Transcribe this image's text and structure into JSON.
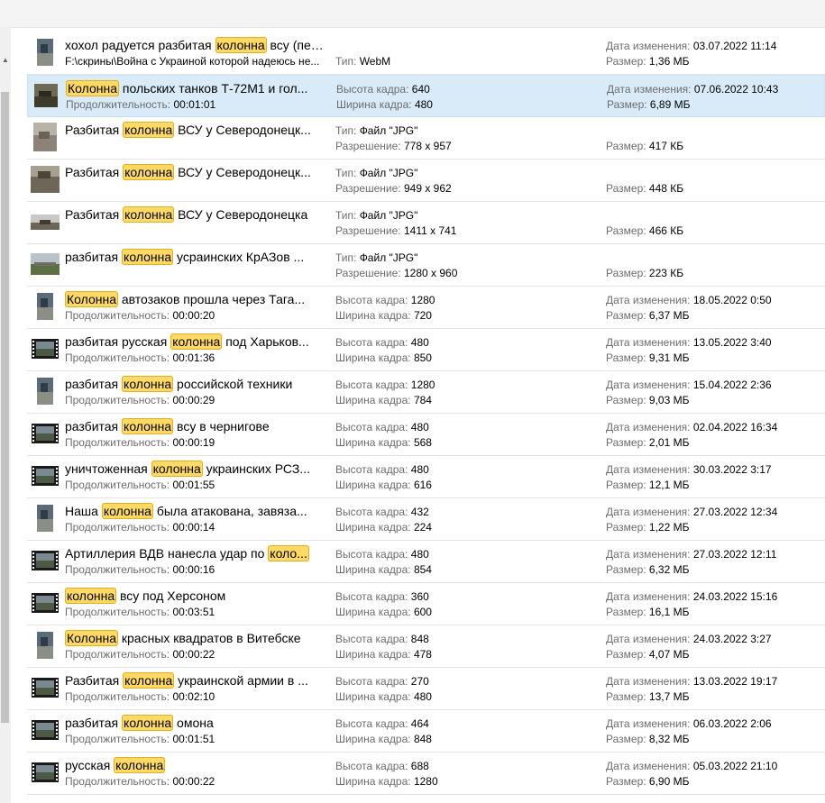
{
  "labels": {
    "date": "Дата изменения:",
    "size": "Размер:",
    "type": "Тип:",
    "resolution": "Разрешение:",
    "height": "Высота кадра:",
    "width": "Ширина кадра:",
    "duration": "Продолжительность:"
  },
  "rows": [
    {
      "kind": "path",
      "pre": "хохол радуется разбитая ",
      "hl": "колонна",
      "post": " всу (первый день войны)",
      "sub": "F:\\скрины\\Война с Украиной которой надеюсь не...",
      "c2a_label": "",
      "c2a": "",
      "c2b_label": "Тип:",
      "c2b": "WebM",
      "c3a_label": "Дата изменения:",
      "c3a": "03.07.2022 11:14",
      "c3b_label": "Размер:",
      "c3b": "1,36 МБ",
      "thumb": "portrait-video"
    },
    {
      "kind": "video",
      "pre": "",
      "hl": "Колонна",
      "post": " польских танков Т-72М1 и гол...",
      "sub": "00:01:01",
      "c2a_label": "Высота кадра:",
      "c2a": "640",
      "c2b_label": "Ширина кадра:",
      "c2b": "480",
      "c3a_label": "Дата изменения:",
      "c3a": "07.06.2022 10:43",
      "c3b_label": "Размер:",
      "c3b": "6,89 МБ",
      "thumb": "landscape-video",
      "selected": true
    },
    {
      "kind": "image",
      "pre": "Разбитая ",
      "hl": "колонна",
      "post": " ВСУ у Северодонецк...",
      "sub": "",
      "c2a_label": "Тип:",
      "c2a": "Файл \"JPG\"",
      "c2b_label": "Разрешение:",
      "c2b": "778 x 957",
      "c3a_label": "",
      "c3a": "",
      "c3b_label": "Размер:",
      "c3b": "417 КБ",
      "thumb": "photo-portrait"
    },
    {
      "kind": "image",
      "pre": "Разбитая ",
      "hl": "колонна",
      "post": " ВСУ у Северодонецк...",
      "sub": "",
      "c2a_label": "Тип:",
      "c2a": "Файл \"JPG\"",
      "c2b_label": "Разрешение:",
      "c2b": "949 x 962",
      "c3a_label": "",
      "c3a": "",
      "c3b_label": "Размер:",
      "c3b": "448 КБ",
      "thumb": "photo-square"
    },
    {
      "kind": "image",
      "pre": "Разбитая ",
      "hl": "колонна",
      "post": " ВСУ у Северодонецка",
      "sub": "",
      "c2a_label": "Тип:",
      "c2a": "Файл \"JPG\"",
      "c2b_label": "Разрешение:",
      "c2b": "1411 x 741",
      "c3a_label": "",
      "c3a": "",
      "c3b_label": "Размер:",
      "c3b": "466 КБ",
      "thumb": "photo-wide"
    },
    {
      "kind": "image",
      "pre": "разбитая ",
      "hl": "колонна",
      "post": " усраинских КрАЗов ...",
      "sub": "",
      "c2a_label": "Тип:",
      "c2a": "Файл \"JPG\"",
      "c2b_label": "Разрешение:",
      "c2b": "1280 x 960",
      "c3a_label": "",
      "c3a": "",
      "c3b_label": "Размер:",
      "c3b": "223 КБ",
      "thumb": "photo-landscape"
    },
    {
      "kind": "video",
      "pre": "",
      "hl": "Колонна",
      "post": " автозаков прошла через Тага...",
      "sub": "00:00:20",
      "c2a_label": "Высота кадра:",
      "c2a": "1280",
      "c2b_label": "Ширина кадра:",
      "c2b": "720",
      "c3a_label": "Дата изменения:",
      "c3a": "18.05.2022 0:50",
      "c3b_label": "Размер:",
      "c3b": "6,37 МБ",
      "thumb": "portrait-video"
    },
    {
      "kind": "video",
      "pre": "разбитая русская ",
      "hl": "колонна",
      "post": " под Харьков...",
      "sub": "00:01:36",
      "c2a_label": "Высота кадра:",
      "c2a": "480",
      "c2b_label": "Ширина кадра:",
      "c2b": "850",
      "c3a_label": "Дата изменения:",
      "c3a": "13.05.2022 3:40",
      "c3b_label": "Размер:",
      "c3b": "9,31 МБ",
      "thumb": "film"
    },
    {
      "kind": "video",
      "pre": "разбитая ",
      "hl": "колонна",
      "post": " российской техники",
      "sub": "00:00:29",
      "c2a_label": "Высота кадра:",
      "c2a": "1280",
      "c2b_label": "Ширина кадра:",
      "c2b": "784",
      "c3a_label": "Дата изменения:",
      "c3a": "15.04.2022 2:36",
      "c3b_label": "Размер:",
      "c3b": "9,03 МБ",
      "thumb": "portrait-video"
    },
    {
      "kind": "video",
      "pre": "разбитая ",
      "hl": "колонна",
      "post": " всу в чернигове",
      "sub": "00:00:19",
      "c2a_label": "Высота кадра:",
      "c2a": "480",
      "c2b_label": "Ширина кадра:",
      "c2b": "568",
      "c3a_label": "Дата изменения:",
      "c3a": "02.04.2022 16:34",
      "c3b_label": "Размер:",
      "c3b": "2,01 МБ",
      "thumb": "film"
    },
    {
      "kind": "video",
      "pre": "уничтоженная ",
      "hl": "колонна",
      "post": " украинских РСЗ...",
      "sub": "00:01:55",
      "c2a_label": "Высота кадра:",
      "c2a": "480",
      "c2b_label": "Ширина кадра:",
      "c2b": "616",
      "c3a_label": "Дата изменения:",
      "c3a": "30.03.2022 3:17",
      "c3b_label": "Размер:",
      "c3b": "12,1 МБ",
      "thumb": "film"
    },
    {
      "kind": "video",
      "pre": "Наша ",
      "hl": "колонна",
      "post": " была атакована, завяза...",
      "sub": "00:00:14",
      "c2a_label": "Высота кадра:",
      "c2a": "432",
      "c2b_label": "Ширина кадра:",
      "c2b": "224",
      "c3a_label": "Дата изменения:",
      "c3a": "27.03.2022 12:34",
      "c3b_label": "Размер:",
      "c3b": "1,22 МБ",
      "thumb": "portrait-video"
    },
    {
      "kind": "video",
      "pre": "Артиллерия ВДВ нанесла удар по ",
      "hl": "коло...",
      "post": "",
      "sub": "00:00:16",
      "c2a_label": "Высота кадра:",
      "c2a": "480",
      "c2b_label": "Ширина кадра:",
      "c2b": "854",
      "c3a_label": "Дата изменения:",
      "c3a": "27.03.2022 12:11",
      "c3b_label": "Размер:",
      "c3b": "6,32 МБ",
      "thumb": "film"
    },
    {
      "kind": "video",
      "pre": "",
      "hl": "колонна",
      "post": " всу под Херсоном",
      "sub": "00:03:51",
      "c2a_label": "Высота кадра:",
      "c2a": "360",
      "c2b_label": "Ширина кадра:",
      "c2b": "600",
      "c3a_label": "Дата изменения:",
      "c3a": "24.03.2022 15:16",
      "c3b_label": "Размер:",
      "c3b": "16,1 МБ",
      "thumb": "film"
    },
    {
      "kind": "video",
      "pre": "",
      "hl": "Колонна",
      "post": " красных квадратов в Витебске",
      "sub": "00:00:22",
      "c2a_label": "Высота кадра:",
      "c2a": "848",
      "c2b_label": "Ширина кадра:",
      "c2b": "478",
      "c3a_label": "Дата изменения:",
      "c3a": "24.03.2022 3:27",
      "c3b_label": "Размер:",
      "c3b": "4,07 МБ",
      "thumb": "portrait-video"
    },
    {
      "kind": "video",
      "pre": "Разбитая ",
      "hl": "колонна",
      "post": " украинской армии в ...",
      "sub": "00:02:10",
      "c2a_label": "Высота кадра:",
      "c2a": "270",
      "c2b_label": "Ширина кадра:",
      "c2b": "480",
      "c3a_label": "Дата изменения:",
      "c3a": "13.03.2022 19:17",
      "c3b_label": "Размер:",
      "c3b": "13,7 МБ",
      "thumb": "film"
    },
    {
      "kind": "video",
      "pre": "разбитая ",
      "hl": "колонна",
      "post": " омона",
      "sub": "00:01:51",
      "c2a_label": "Высота кадра:",
      "c2a": "464",
      "c2b_label": "Ширина кадра:",
      "c2b": "848",
      "c3a_label": "Дата изменения:",
      "c3a": "06.03.2022 2:06",
      "c3b_label": "Размер:",
      "c3b": "8,32 МБ",
      "thumb": "film"
    },
    {
      "kind": "video",
      "pre": "русская ",
      "hl": "колонна",
      "post": "",
      "sub": "00:00:22",
      "c2a_label": "Высота кадра:",
      "c2a": "688",
      "c2b_label": "Ширина кадра:",
      "c2b": "1280",
      "c3a_label": "Дата изменения:",
      "c3a": "05.03.2022 21:10",
      "c3b_label": "Размер:",
      "c3b": "6,90 МБ",
      "thumb": "film"
    }
  ]
}
